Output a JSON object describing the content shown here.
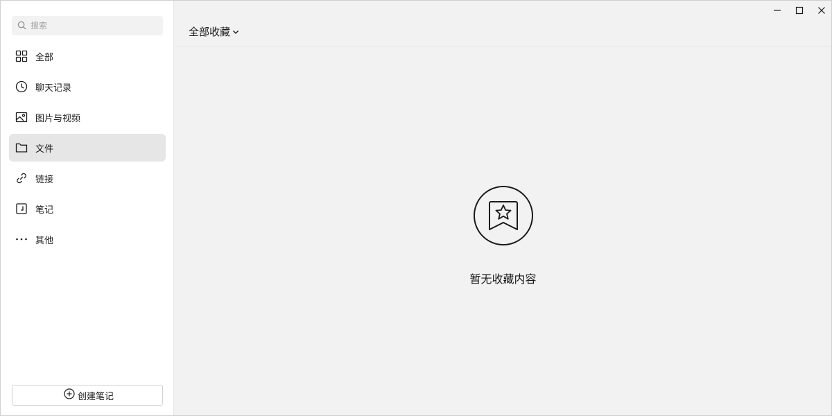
{
  "search": {
    "placeholder": "搜索",
    "icon": "search-icon"
  },
  "sidebar": {
    "items": [
      {
        "label": "全部",
        "icon": "grid-icon",
        "active": false
      },
      {
        "label": "聊天记录",
        "icon": "clock-icon",
        "active": false
      },
      {
        "label": "图片与视频",
        "icon": "image-icon",
        "active": false
      },
      {
        "label": "文件",
        "icon": "folder-icon",
        "active": true
      },
      {
        "label": "链接",
        "icon": "link-icon",
        "active": false
      },
      {
        "label": "笔记",
        "icon": "note-icon",
        "active": false
      },
      {
        "label": "其他",
        "icon": "more-icon",
        "active": false
      }
    ],
    "create_label": "创建笔记"
  },
  "main": {
    "filter_label": "全部收藏",
    "empty_text": "暂无收藏内容"
  },
  "colors": {
    "sidebar_bg": "#ffffff",
    "main_bg": "#f2f2f2",
    "active_bg": "#e6e6e6"
  }
}
